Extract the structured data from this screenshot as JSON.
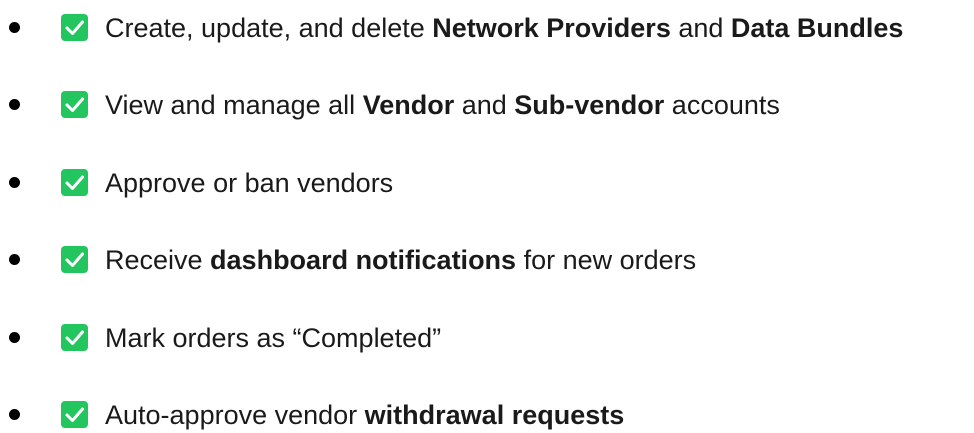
{
  "items": [
    {
      "icon": "check-square-icon",
      "segments": [
        {
          "text": "Create, update, and delete ",
          "bold": false
        },
        {
          "text": "Network Providers",
          "bold": true
        },
        {
          "text": " and ",
          "bold": false
        },
        {
          "text": "Data Bundles",
          "bold": true
        }
      ]
    },
    {
      "icon": "check-square-icon",
      "segments": [
        {
          "text": "View and manage all ",
          "bold": false
        },
        {
          "text": "Vendor",
          "bold": true
        },
        {
          "text": " and ",
          "bold": false
        },
        {
          "text": "Sub-vendor",
          "bold": true
        },
        {
          "text": " accounts",
          "bold": false
        }
      ]
    },
    {
      "icon": "check-square-icon",
      "segments": [
        {
          "text": "Approve or ban vendors",
          "bold": false
        }
      ]
    },
    {
      "icon": "check-square-icon",
      "segments": [
        {
          "text": "Receive ",
          "bold": false
        },
        {
          "text": "dashboard notifications",
          "bold": true
        },
        {
          "text": " for new orders",
          "bold": false
        }
      ]
    },
    {
      "icon": "check-square-icon",
      "segments": [
        {
          "text": "Mark orders as “Completed”",
          "bold": false
        }
      ]
    },
    {
      "icon": "check-square-icon",
      "segments": [
        {
          "text": "Auto-approve vendor ",
          "bold": false
        },
        {
          "text": "withdrawal requests",
          "bold": true
        }
      ]
    }
  ],
  "colors": {
    "check_background": "#22c55e",
    "check_mark": "#ffffff",
    "text": "#1a1a1a",
    "bullet": "#000000"
  }
}
